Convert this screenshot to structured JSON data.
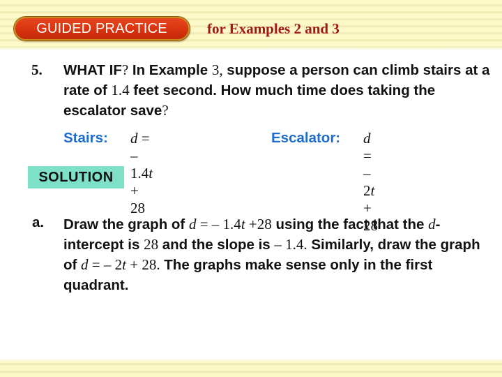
{
  "header": {
    "badge_label": "GUIDED PRACTICE",
    "subtitle": "for Examples 2 and 3",
    "colors": {
      "badge": "#d9330f",
      "subtitle": "#a01818",
      "band": "#fdf9c8"
    }
  },
  "question": {
    "number": "5.",
    "segments": [
      {
        "t": "WHAT IF",
        "s": "b"
      },
      {
        "t": "?",
        "s": "m"
      },
      {
        "t": " In Example ",
        "s": "b"
      },
      {
        "t": "3",
        "s": "m"
      },
      {
        "t": ",",
        "s": "m"
      },
      {
        "t": " suppose a person can climb stairs at a rate of ",
        "s": "b"
      },
      {
        "t": "1.4",
        "s": "m"
      },
      {
        "t": " feet second. How much time does taking the escalator save",
        "s": "b"
      },
      {
        "t": "?",
        "s": "m"
      }
    ]
  },
  "equations": {
    "stairs_label": "Stairs:",
    "stairs_var": "d",
    "stairs_mid": " = – 1.4",
    "stairs_var2": "t",
    "stairs_end": " + 28",
    "escalator_label": "Escalator:",
    "escalator_var": "d",
    "escalator_mid": " = – 2",
    "escalator_var2": "t",
    "escalator_end": " + 28",
    "label_color": "#1f6ccc"
  },
  "solution": {
    "label": "SOLUTION",
    "color": "#7fe0c8",
    "part_label": "a.",
    "segments": [
      {
        "t": "Draw the graph of ",
        "s": "b"
      },
      {
        "t": "d",
        "s": "mi"
      },
      {
        "t": " = – 1.4",
        "s": "m"
      },
      {
        "t": "t",
        "s": "mi"
      },
      {
        "t": " +28",
        "s": "m"
      },
      {
        "t": " using the fact that the ",
        "s": "b"
      },
      {
        "t": "d",
        "s": "mi"
      },
      {
        "t": "-intercept is ",
        "s": "b"
      },
      {
        "t": "28",
        "s": "m"
      },
      {
        "t": " and the slope is ",
        "s": "b"
      },
      {
        "t": "– 1.4.",
        "s": "m"
      },
      {
        "t": " Similarly, draw the graph of ",
        "s": "b"
      },
      {
        "t": "d",
        "s": "mi"
      },
      {
        "t": " = – 2",
        "s": "m"
      },
      {
        "t": "t",
        "s": "mi"
      },
      {
        "t": " + 28.",
        "s": "m"
      },
      {
        "t": " The graphs make sense only in the first quadrant.",
        "s": "b"
      }
    ]
  }
}
